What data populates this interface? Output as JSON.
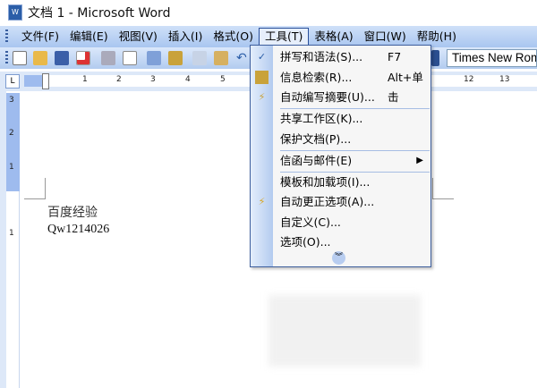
{
  "window": {
    "title": "文档 1 - Microsoft Word"
  },
  "menubar": {
    "items": [
      "文件(F)",
      "编辑(E)",
      "视图(V)",
      "插入(I)",
      "格式(O)",
      "工具(T)",
      "表格(A)",
      "窗口(W)",
      "帮助(H)"
    ],
    "active": "工具(T)"
  },
  "toolbar": {
    "font": "Times New Rom"
  },
  "ruler": {
    "h_ticks": [
      "1",
      "2",
      "3",
      "4",
      "5",
      "12",
      "13"
    ],
    "v_ticks": [
      "3",
      "2",
      "1",
      "1"
    ]
  },
  "document": {
    "lines": [
      "百度经验",
      "Qw1214026"
    ]
  },
  "tools_menu": {
    "items": [
      {
        "label": "拼写和语法(S)...",
        "shortcut": "F7",
        "icon": "spelling-icon"
      },
      {
        "label": "信息检索(R)...",
        "shortcut": "Alt+单击",
        "icon": "research-icon"
      },
      {
        "label": "自动编写摘要(U)...",
        "icon": "autosummarize-icon"
      },
      {
        "label": "共享工作区(K)..."
      },
      {
        "label": "保护文档(P)..."
      },
      {
        "label": "信函与邮件(E)",
        "submenu": true
      },
      {
        "label": "模板和加载项(I)..."
      },
      {
        "label": "自动更正选项(A)...",
        "icon": "autocorrect-icon"
      },
      {
        "label": "自定义(C)..."
      },
      {
        "label": "选项(O)..."
      }
    ]
  }
}
